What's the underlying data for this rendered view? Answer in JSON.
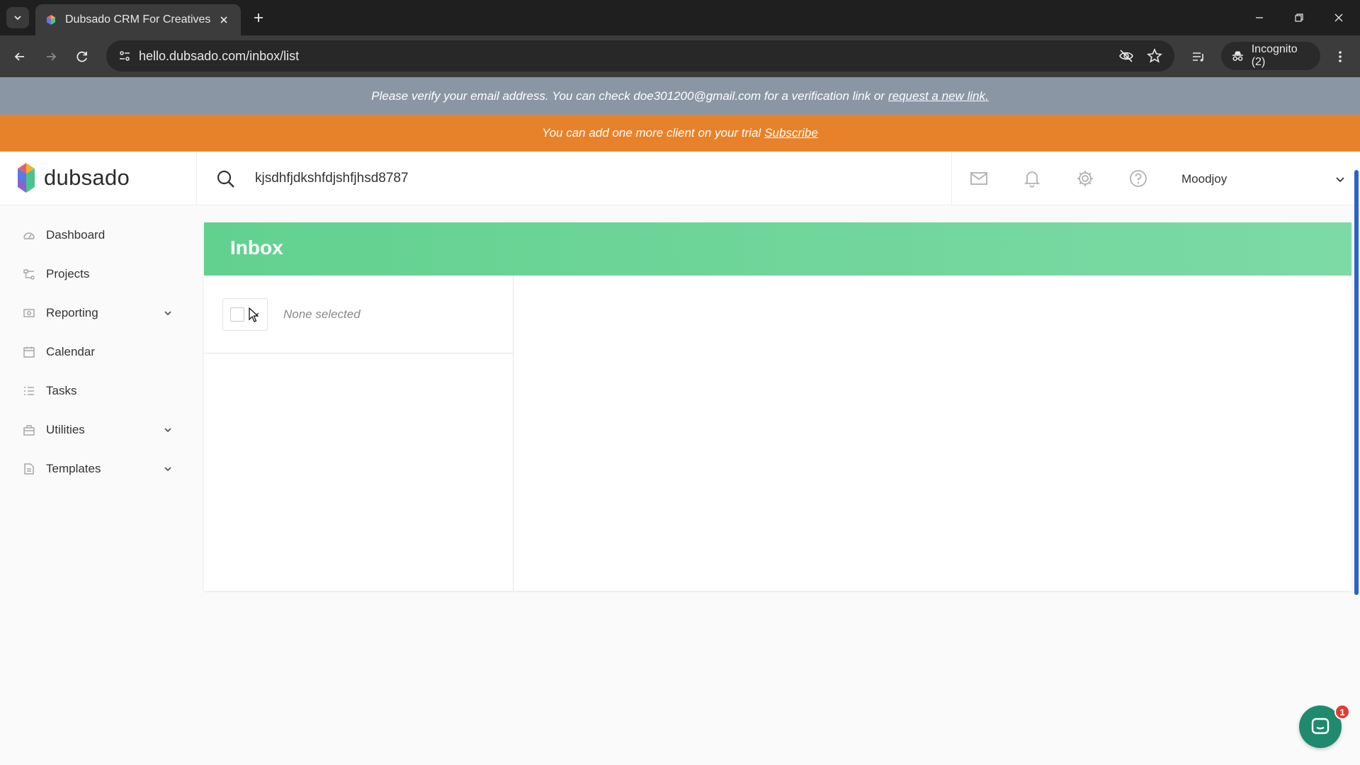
{
  "browser": {
    "tab_title": "Dubsado CRM For Creatives",
    "url": "hello.dubsado.com/inbox/list",
    "incognito_label": "Incognito (2)"
  },
  "banners": {
    "verify_text": "Please verify your email address. You can check doe301200@gmail.com for a verification link or",
    "verify_link": "request a new link.",
    "trial_text": "You can add one more client on your trial",
    "trial_link": "Subscribe"
  },
  "header": {
    "logo_text": "dubsado",
    "search_value": "kjsdhfjdkshfdjshfjhsd8787",
    "user_name": "Moodjoy"
  },
  "sidebar": {
    "items": [
      {
        "label": "Dashboard",
        "icon": "dashboard-icon",
        "expandable": false
      },
      {
        "label": "Projects",
        "icon": "projects-icon",
        "expandable": false
      },
      {
        "label": "Reporting",
        "icon": "reporting-icon",
        "expandable": true
      },
      {
        "label": "Calendar",
        "icon": "calendar-icon",
        "expandable": false
      },
      {
        "label": "Tasks",
        "icon": "tasks-icon",
        "expandable": false
      },
      {
        "label": "Utilities",
        "icon": "utilities-icon",
        "expandable": true
      },
      {
        "label": "Templates",
        "icon": "templates-icon",
        "expandable": true
      }
    ]
  },
  "inbox": {
    "title": "Inbox",
    "selection_status": "None selected"
  },
  "chat": {
    "badge_count": "1"
  },
  "colors": {
    "verify_banner": "#8a96a3",
    "trial_banner": "#e8822a",
    "inbox_header": "#62d18f",
    "chat_button": "#1f8a6e"
  }
}
